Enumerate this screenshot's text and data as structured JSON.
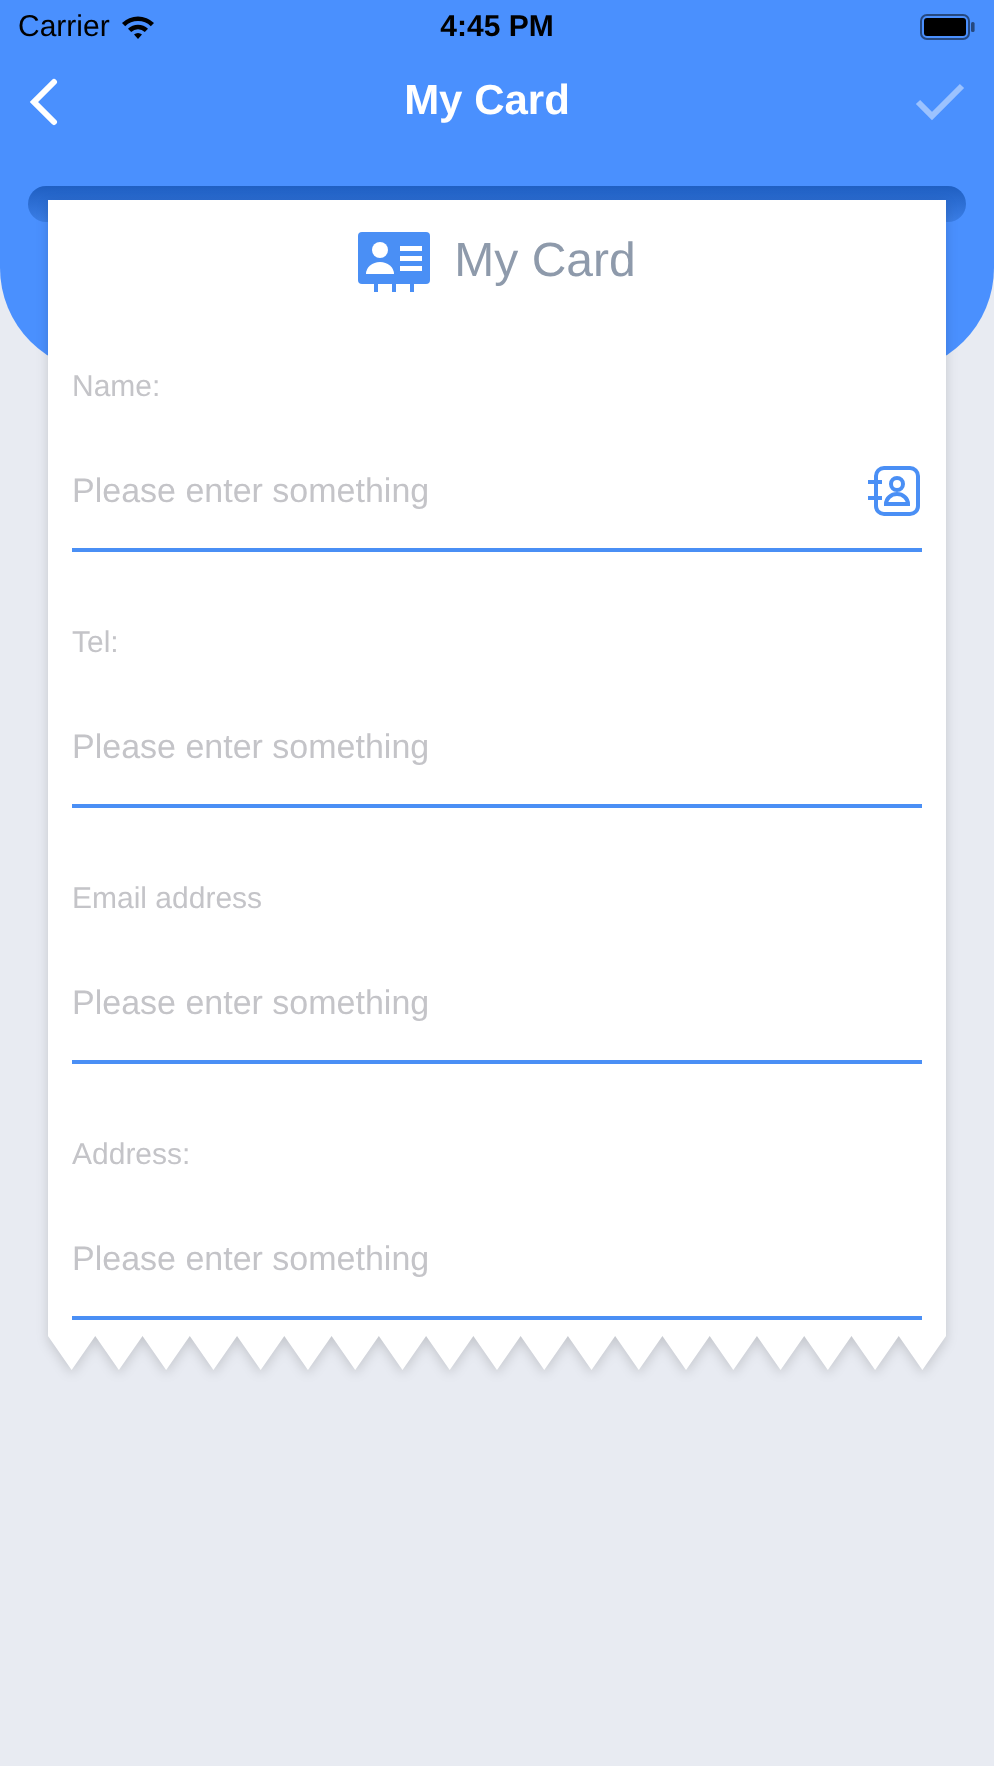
{
  "status_bar": {
    "carrier": "Carrier",
    "time": "4:45 PM"
  },
  "nav": {
    "title": "My Card",
    "done_disabled": true
  },
  "card": {
    "title": "My Card",
    "fields": [
      {
        "label": "Name:",
        "placeholder": "Please enter something",
        "kind": "contact"
      },
      {
        "label": "Tel:",
        "placeholder": "Please enter something",
        "kind": "plain"
      },
      {
        "label": "Email address",
        "placeholder": "Please enter something",
        "kind": "plain"
      },
      {
        "label": "Address:",
        "placeholder": "Please enter something",
        "kind": "plain"
      }
    ]
  }
}
